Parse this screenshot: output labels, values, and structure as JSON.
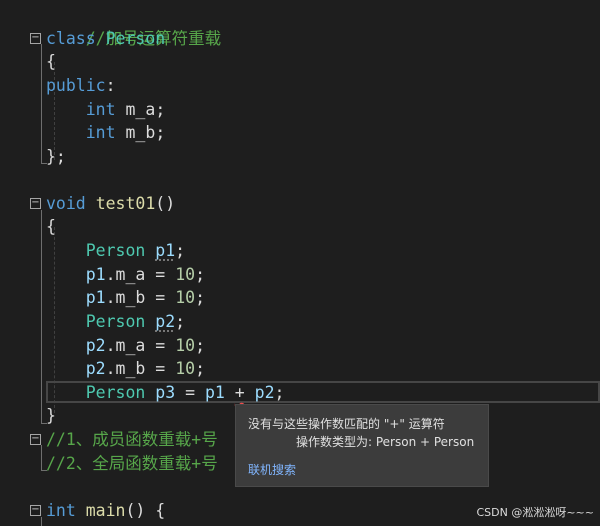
{
  "code": {
    "l1": "//加号运算符重载",
    "l2_kw": "class",
    "l2_name": "Person",
    "l3": "{",
    "l4_kw": "public",
    "l4_colon": ":",
    "l5_kw": "int",
    "l5_var": "m_a",
    "l5_end": ";",
    "l6_kw": "int",
    "l6_var": "m_b",
    "l6_end": ";",
    "l7": "};",
    "l9_kw": "void",
    "l9_fn": "test01",
    "l9_paren": "()",
    "l10": "{",
    "l11_type": "Person",
    "l11_var": "p1",
    "l11_end": ";",
    "l12_obj": "p1",
    "l12_mem": ".m_a",
    "l12_op": " = ",
    "l12_num": "10",
    "l12_end": ";",
    "l13_obj": "p1",
    "l13_mem": ".m_b",
    "l13_op": " = ",
    "l13_num": "10",
    "l13_end": ";",
    "l14_type": "Person",
    "l14_var": "p2",
    "l14_end": ";",
    "l15_obj": "p2",
    "l15_mem": ".m_a",
    "l15_op": " = ",
    "l15_num": "10",
    "l15_end": ";",
    "l16_obj": "p2",
    "l16_mem": ".m_b",
    "l16_op": " = ",
    "l16_num": "10",
    "l16_end": ";",
    "l17_type": "Person",
    "l17_var": "p3",
    "l17_eq": " = ",
    "l17_a": "p1",
    "l17_plus": "+",
    "l17_b": "p2",
    "l17_end": ";",
    "l18": "}",
    "l19": "//1、成员函数重载+号",
    "l20": "//2、全局函数重载+号",
    "l22_kw": "int",
    "l22_fn": "main",
    "l22_rest": "() {"
  },
  "fold_glyph": "−",
  "tooltip": {
    "line1": "没有与这些操作数匹配的 \"+\" 运算符",
    "line2": "操作数类型为:  Person + Person",
    "link": "联机搜索"
  },
  "watermark": "CSDN @淞淞淞呀~~~",
  "colors": {
    "background": "#1e1e1e",
    "comment": "#57a64a",
    "keyword": "#569cd6",
    "type": "#4ec9b0",
    "variable": "#9cdcfe",
    "function": "#dcdcaa",
    "number": "#b5cea8",
    "tooltip_bg": "#3c3c3c",
    "link": "#81b6ff"
  }
}
